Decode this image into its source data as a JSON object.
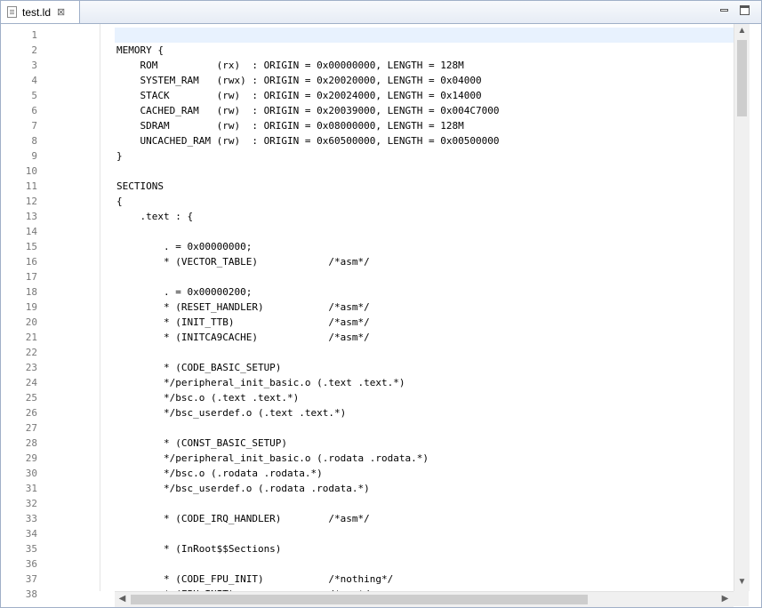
{
  "tab": {
    "label": "test.ld",
    "close": "⊠",
    "icon": "document-icon"
  },
  "window": {
    "minimize_icon": "minimize-icon",
    "maximize_icon": "maximize-icon"
  },
  "scroll": {
    "up": "▲",
    "down": "▼",
    "left": "◀",
    "right": "▶"
  },
  "editor": {
    "line_numbers": [
      "1",
      "2",
      "3",
      "4",
      "5",
      "6",
      "7",
      "8",
      "9",
      "10",
      "11",
      "12",
      "13",
      "14",
      "15",
      "16",
      "17",
      "18",
      "19",
      "20",
      "21",
      "22",
      "23",
      "24",
      "25",
      "26",
      "27",
      "28",
      "29",
      "30",
      "31",
      "32",
      "33",
      "34",
      "35",
      "36",
      "37",
      "38"
    ],
    "lines": [
      "",
      "MEMORY {",
      "    ROM          (rx)  : ORIGIN = 0x00000000, LENGTH = 128M",
      "    SYSTEM_RAM   (rwx) : ORIGIN = 0x20020000, LENGTH = 0x04000",
      "    STACK        (rw)  : ORIGIN = 0x20024000, LENGTH = 0x14000",
      "    CACHED_RAM   (rw)  : ORIGIN = 0x20039000, LENGTH = 0x004C7000",
      "    SDRAM        (rw)  : ORIGIN = 0x08000000, LENGTH = 128M",
      "    UNCACHED_RAM (rw)  : ORIGIN = 0x60500000, LENGTH = 0x00500000",
      "}",
      "",
      "SECTIONS",
      "{",
      "    .text : {",
      "",
      "        . = 0x00000000;",
      "        * (VECTOR_TABLE)            /*asm*/",
      "",
      "        . = 0x00000200;",
      "        * (RESET_HANDLER)           /*asm*/",
      "        * (INIT_TTB)                /*asm*/",
      "        * (INITCA9CACHE)            /*asm*/",
      "",
      "        * (CODE_BASIC_SETUP)",
      "        */peripheral_init_basic.o (.text .text.*)",
      "        */bsc.o (.text .text.*)",
      "        */bsc_userdef.o (.text .text.*)",
      "",
      "        * (CONST_BASIC_SETUP)",
      "        */peripheral_init_basic.o (.rodata .rodata.*)",
      "        */bsc.o (.rodata .rodata.*)",
      "        */bsc_userdef.o (.rodata .rodata.*)",
      "",
      "        * (CODE_IRQ_HANDLER)        /*asm*/",
      "",
      "        * (InRoot$$Sections)",
      "",
      "        * (CODE_FPU_INIT)           /*nothing*/",
      "        * (FPU_INIT)                /*asm*/"
    ]
  },
  "colors": {
    "current_line": "#e8f2fe",
    "line_number": "#787878",
    "border": "#a0b0c8"
  }
}
